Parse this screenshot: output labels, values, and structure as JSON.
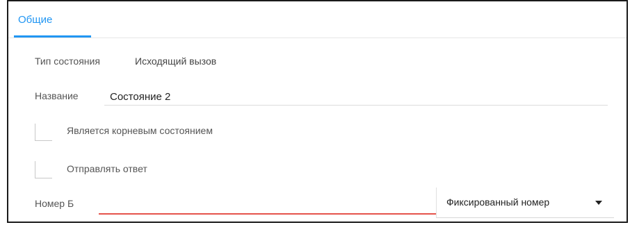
{
  "tabs": [
    {
      "label": "Общие",
      "active": true
    }
  ],
  "form": {
    "state_type": {
      "label": "Тип состояния",
      "value": "Исходящий вызов"
    },
    "name": {
      "label": "Название",
      "value": "Состояние 2"
    },
    "is_root": {
      "label": "Является корневым состоянием",
      "checked": false
    },
    "send_reply": {
      "label": "Отправлять ответ",
      "checked": false
    },
    "number_b": {
      "label": "Номер Б",
      "value": "",
      "source_selected": "Фиксированный номер"
    }
  },
  "colors": {
    "accent": "#2196f3",
    "error_underline": "#e5534b",
    "frame_border": "#1a1a1a"
  },
  "icons": {
    "dropdown": "caret-down-icon"
  }
}
